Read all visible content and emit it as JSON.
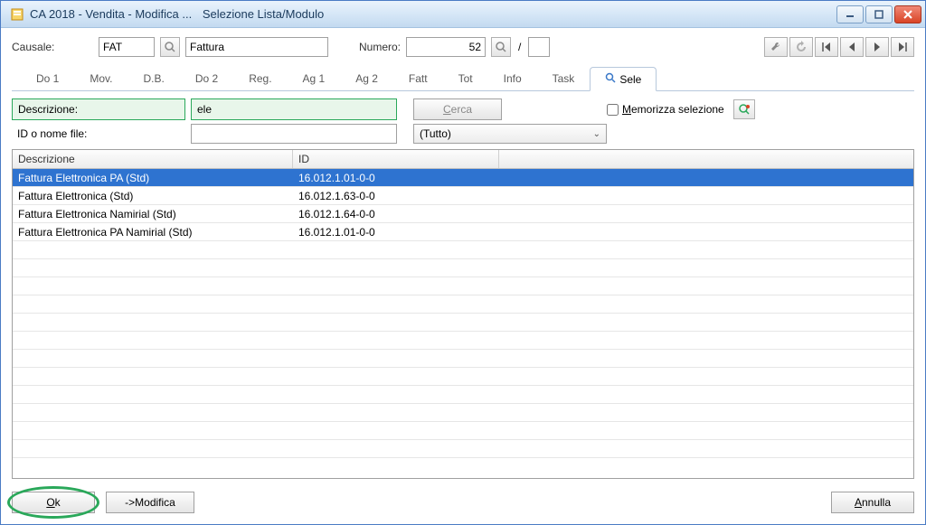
{
  "title": {
    "main": "CA 2018 - Vendita - Modifica ...",
    "sub": "Selezione Lista/Modulo"
  },
  "row1": {
    "causale_label": "Causale:",
    "causale_code": "FAT",
    "causale_desc": "Fattura",
    "numero_label": "Numero:",
    "numero_value": "52",
    "numero_ext": ""
  },
  "tabs": [
    "Do 1",
    "Mov.",
    "D.B.",
    "Do 2",
    "Reg.",
    "Ag 1",
    "Ag 2",
    "Fatt",
    "Tot",
    "Info",
    "Task",
    "Sele"
  ],
  "active_tab_index": 11,
  "filter": {
    "descrizione_label": "Descrizione:",
    "descrizione_value": "ele",
    "cerca_label": "Cerca",
    "memorizza_label": "Memorizza selezione",
    "id_file_label": "ID o nome file:",
    "id_file_value": "",
    "combo_value": "(Tutto)"
  },
  "grid": {
    "headers": {
      "desc": "Descrizione",
      "id": "ID"
    },
    "rows": [
      {
        "desc": "Fattura Elettronica PA (Std)",
        "id": "16.012.1.01-0-0",
        "selected": true
      },
      {
        "desc": "Fattura Elettronica (Std)",
        "id": "16.012.1.63-0-0",
        "selected": false
      },
      {
        "desc": "Fattura Elettronica Namirial (Std)",
        "id": "16.012.1.64-0-0",
        "selected": false
      },
      {
        "desc": "Fattura Elettronica PA Namirial (Std)",
        "id": "16.012.1.01-0-0",
        "selected": false
      }
    ]
  },
  "footer": {
    "ok": "Ok",
    "modifica": "->Modifica",
    "annulla": "Annulla"
  }
}
